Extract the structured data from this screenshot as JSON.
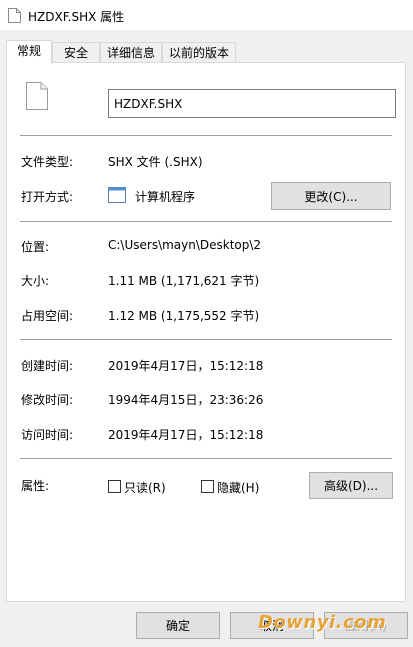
{
  "window": {
    "title": "HZDXF.SHX 属性"
  },
  "tabs": [
    {
      "label": "常规",
      "active": true
    },
    {
      "label": "安全",
      "active": false
    },
    {
      "label": "详细信息",
      "active": false
    },
    {
      "label": "以前的版本",
      "active": false
    }
  ],
  "general": {
    "file_name": "HZDXF.SHX",
    "file_type_label": "文件类型:",
    "file_type_value": "SHX 文件 (.SHX)",
    "open_with_label": "打开方式:",
    "open_with_value": "计算机程序",
    "change_button": "更改(C)...",
    "location_label": "位置:",
    "location_value": "C:\\Users\\mayn\\Desktop\\2",
    "size_label": "大小:",
    "size_value": "1.11 MB (1,171,621 字节)",
    "size_on_disk_label": "占用空间:",
    "size_on_disk_value": "1.12 MB (1,175,552 字节)",
    "created_label": "创建时间:",
    "created_value": "2019年4月17日，15:12:18",
    "modified_label": "修改时间:",
    "modified_value": "1994年4月15日，23:36:26",
    "accessed_label": "访问时间:",
    "accessed_value": "2019年4月17日，15:12:18",
    "attributes_label": "属性:",
    "readonly_label": "只读(R)",
    "readonly_checked": false,
    "hidden_label": "隐藏(H)",
    "hidden_checked": false,
    "advanced_button": "高级(D)..."
  },
  "footer": {
    "ok_button": "确定",
    "cancel_button": "取消",
    "apply_button": "应用(A)"
  },
  "watermark": "Downyi.com"
}
